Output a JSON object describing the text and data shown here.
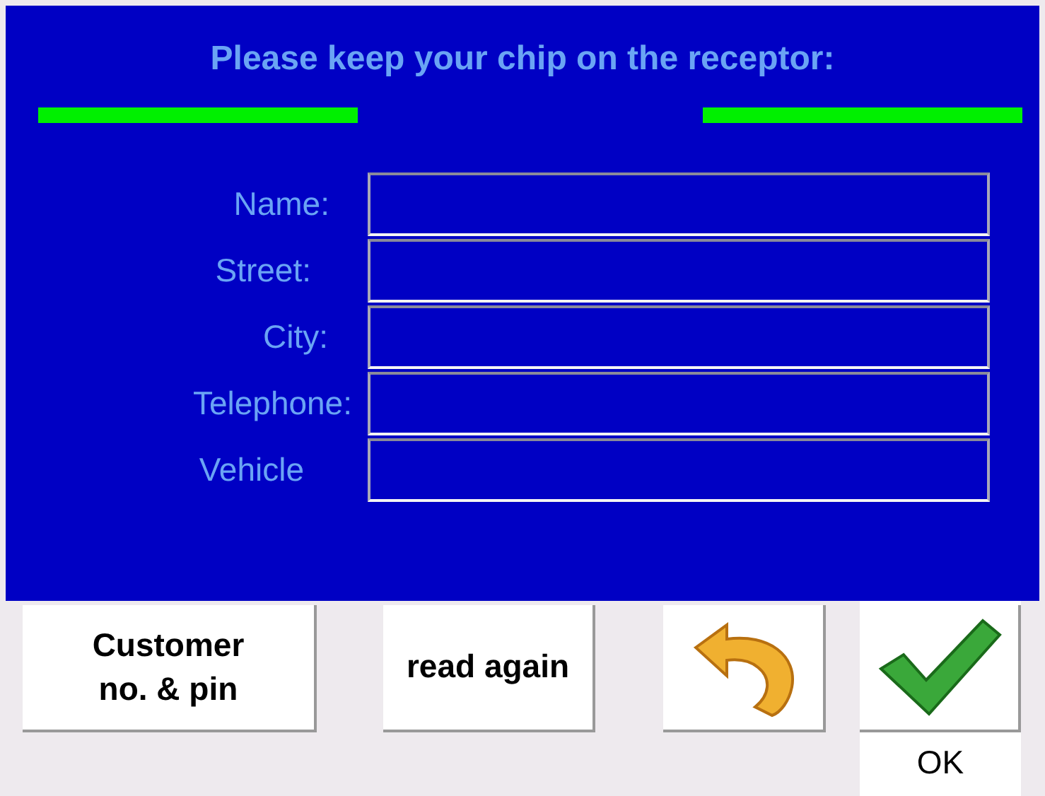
{
  "title": "Please keep your chip on the receptor:",
  "fields": [
    {
      "label": "Name:"
    },
    {
      "label": "Street:"
    },
    {
      "label": "City:"
    },
    {
      "label": "Telephone:"
    },
    {
      "label": "Vehicle"
    }
  ],
  "buttons": [
    {
      "kind": "text",
      "label": "Customer\nno. & pin"
    },
    {
      "kind": "text",
      "label": "read again"
    },
    {
      "kind": "undo"
    },
    {
      "kind": "ok",
      "caption": "OK"
    }
  ]
}
